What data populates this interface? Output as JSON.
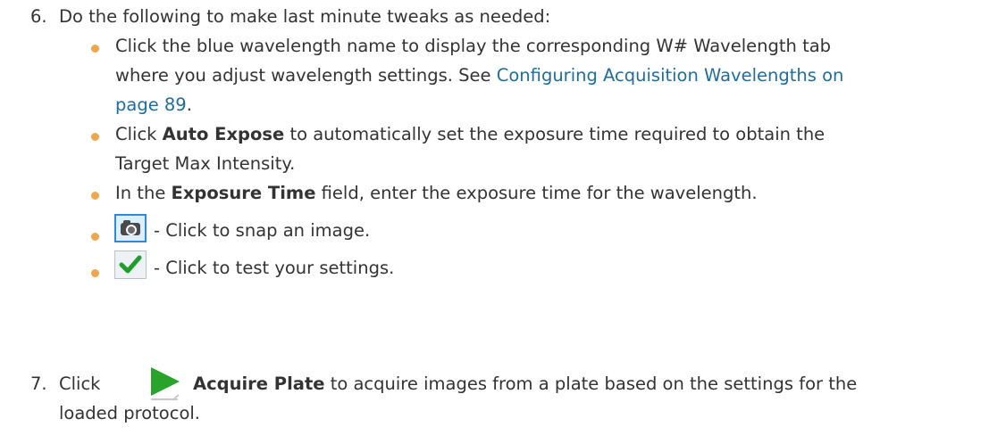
{
  "step6": {
    "number": "6.",
    "intro": "Do the following to make last minute tweaks as needed:",
    "items": [
      {
        "line1": "Click the blue wavelength name to display the corresponding W# Wavelength tab",
        "line2_prefix": "where you adjust wavelength settings. See ",
        "link_part1": "Configuring Acquisition Wavelengths on",
        "link_part2": "page 89",
        "line3_suffix": "."
      },
      {
        "prefix": "Click ",
        "bold": "Auto Expose",
        "suffix": " to automatically set the exposure time required to obtain the",
        "line2": "Target Max Intensity."
      },
      {
        "prefix": "In the ",
        "bold": "Exposure Time",
        "suffix": " field, enter the exposure time for the wavelength."
      },
      {
        "icon": "camera-icon",
        "text": "- Click to snap an image."
      },
      {
        "icon": "checkmark-icon",
        "text": "- Click to test your settings."
      }
    ]
  },
  "step7": {
    "number": "7.",
    "prefix": "Click ",
    "icon": "play-icon",
    "bold": "Acquire Plate",
    "suffix": " to acquire images from a plate based on the settings for the",
    "line2": "loaded protocol."
  },
  "colors": {
    "text": "#333333",
    "link": "#1f6d9f",
    "bullet": "#f0a64b",
    "check": "#1f9e2e",
    "play": "#2aa32a"
  }
}
